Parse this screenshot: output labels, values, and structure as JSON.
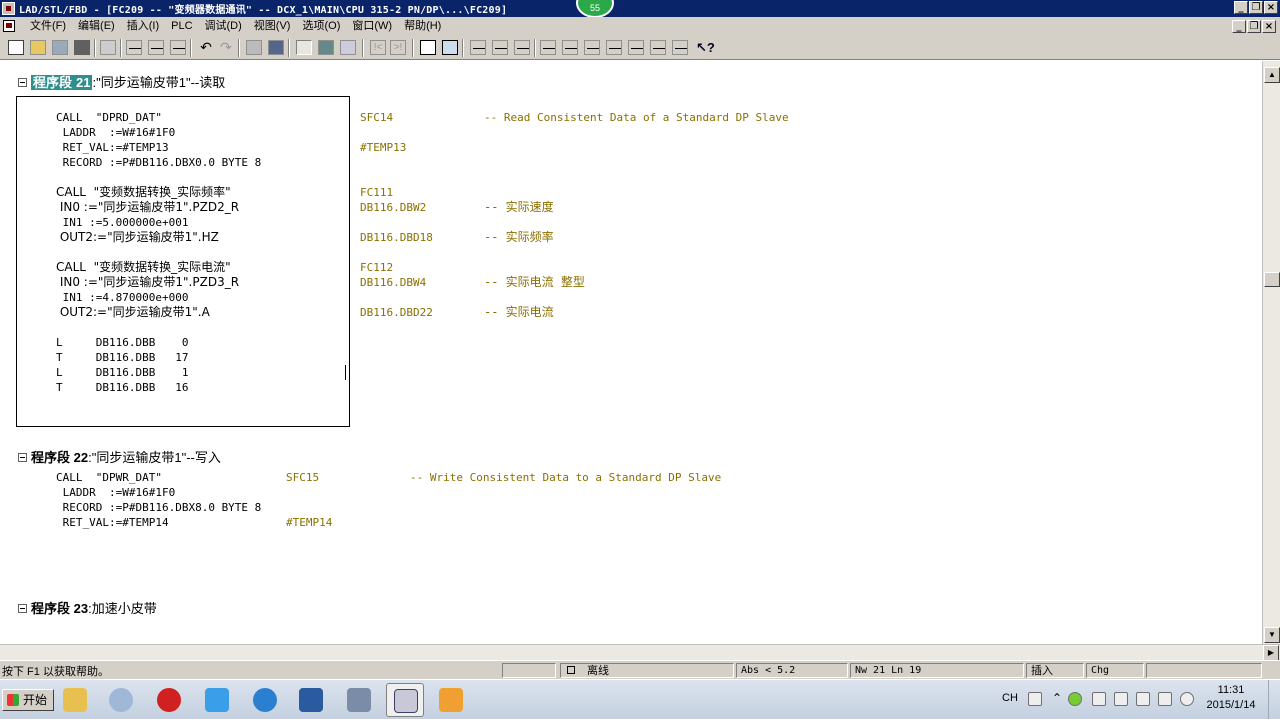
{
  "window": {
    "title": "LAD/STL/FBD  - [FC209 -- \"变频器数据通讯\" -- DCX_1\\MAIN\\CPU 315-2 PN/DP\\...\\FC209]",
    "notification_badge": "55"
  },
  "menu": {
    "items": [
      "文件(F)",
      "编辑(E)",
      "插入(I)",
      "PLC",
      "调试(D)",
      "视图(V)",
      "选项(O)",
      "窗口(W)",
      "帮助(H)"
    ]
  },
  "networks": [
    {
      "label": "程序段",
      "number": "21",
      "separator": ":",
      "title": "\"同步运输皮带1\"--读取"
    },
    {
      "label": "程序段",
      "number": "22",
      "separator": ":",
      "title": "\"同步运输皮带1\"--写入"
    },
    {
      "label": "程序段",
      "number": "23",
      "separator": ":",
      "title": "加速小皮带"
    }
  ],
  "code": {
    "n21": [
      "CALL  \"DPRD_DAT\"",
      " LADDR  :=W#16#1F0",
      " RET_VAL:=#TEMP13",
      " RECORD :=P#DB116.DBX0.0 BYTE 8",
      "CALL  \"变频数据转换_实际频率\"",
      " IN0 :=\"同步运输皮带1\".PZD2_R",
      " IN1 :=5.000000e+001",
      " OUT2:=\"同步运输皮带1\".HZ",
      "CALL  \"变频数据转换_实际电流\"",
      " IN0 :=\"同步运输皮带1\".PZD3_R",
      " IN1 :=4.870000e+000",
      " OUT2:=\"同步运输皮带1\".A",
      "L     DB116.DBB    0",
      "T     DB116.DBB   17",
      "L     DB116.DBB    1",
      "T     DB116.DBB   16"
    ],
    "n21_comments": [
      "SFC14",
      "-- Read Consistent Data of a Standard DP Slave",
      "#TEMP13",
      "FC111",
      "DB116.DBW2",
      "-- 实际速度",
      "DB116.DBD18",
      "-- 实际频率",
      "FC112",
      "DB116.DBW4",
      "-- 实际电流 整型",
      "DB116.DBD22",
      "-- 实际电流"
    ],
    "n22": [
      "CALL  \"DPWR_DAT\"",
      " LADDR  :=W#16#1F0",
      " RECORD :=P#DB116.DBX8.0 BYTE 8",
      " RET_VAL:=#TEMP14"
    ],
    "n22_comments": [
      "SFC15",
      "-- Write Consistent Data to a Standard DP Slave",
      "#TEMP14"
    ]
  },
  "status": {
    "help": "按下 F1 以获取帮助。",
    "mode": "离线",
    "abs": "Abs < 5.2",
    "nw": "Nw 21  Ln 19",
    "insert": "插入",
    "chg": "Chg"
  },
  "taskbar": {
    "start": "开始",
    "lang": "CH",
    "time": "11:31",
    "date": "2015/1/14"
  }
}
